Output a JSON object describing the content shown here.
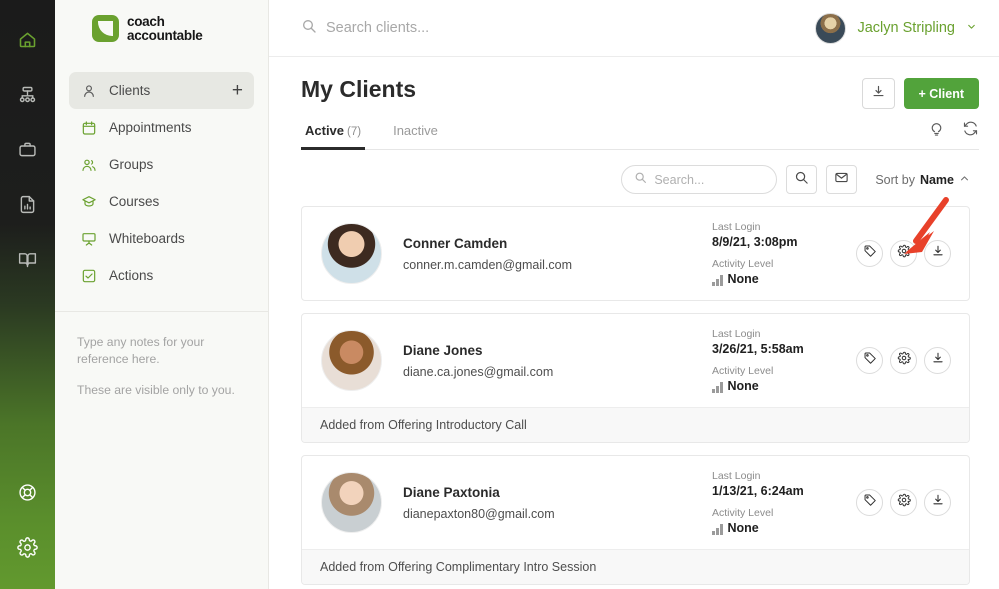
{
  "rail": {
    "items": [
      {
        "name": "home-icon",
        "active": true
      },
      {
        "name": "org-chart-icon",
        "active": false
      },
      {
        "name": "briefcase-icon",
        "active": false
      },
      {
        "name": "report-icon",
        "active": false
      },
      {
        "name": "book-icon",
        "active": false
      }
    ],
    "bottom": [
      {
        "name": "help-lifering-icon"
      },
      {
        "name": "settings-gear-icon"
      }
    ]
  },
  "sidebar": {
    "logo": {
      "line1": "coach",
      "line2": "accountable"
    },
    "nav": [
      {
        "label": "Clients",
        "icon": "person-icon",
        "active": true,
        "plus": "+"
      },
      {
        "label": "Appointments",
        "icon": "calendar-icon",
        "active": false
      },
      {
        "label": "Groups",
        "icon": "people-icon",
        "active": false
      },
      {
        "label": "Courses",
        "icon": "graduation-icon",
        "active": false
      },
      {
        "label": "Whiteboards",
        "icon": "whiteboard-icon",
        "active": false
      },
      {
        "label": "Actions",
        "icon": "checkbox-icon",
        "active": false
      }
    ],
    "notes": {
      "line1": "Type any notes for your reference here.",
      "line2": "These are visible only to you."
    }
  },
  "topbar": {
    "search_placeholder": "Search clients...",
    "user_name": "Jaclyn Stripling"
  },
  "page": {
    "title": "My Clients",
    "download_button": "download-icon",
    "add_client_button": "+ Client",
    "tabs": [
      {
        "label": "Active",
        "count": "(7)",
        "active": true
      },
      {
        "label": "Inactive",
        "count": "",
        "active": false
      }
    ],
    "tab_icons": [
      {
        "name": "lightbulb-icon"
      },
      {
        "name": "refresh-icon"
      }
    ]
  },
  "toolbar": {
    "search_placeholder": "Search...",
    "search_value": "",
    "sort_prefix": "Sort by",
    "sort_value": "Name"
  },
  "clients": [
    {
      "name": "Conner Camden",
      "email": "conner.m.camden@gmail.com",
      "last_login_label": "Last Login",
      "last_login_value": "8/9/21, 3:08pm",
      "activity_label": "Activity Level",
      "activity_value": "None",
      "footer": ""
    },
    {
      "name": "Diane Jones",
      "email": "diane.ca.jones@gmail.com",
      "last_login_label": "Last Login",
      "last_login_value": "3/26/21, 5:58am",
      "activity_label": "Activity Level",
      "activity_value": "None",
      "footer": "Added from Offering Introductory Call"
    },
    {
      "name": "Diane Paxtonia",
      "email": "dianepaxton80@gmail.com",
      "last_login_label": "Last Login",
      "last_login_value": "1/13/21, 6:24am",
      "activity_label": "Activity Level",
      "activity_value": "None",
      "footer": "Added from Offering Complimentary Intro Session"
    }
  ],
  "card_actions": [
    {
      "name": "tag-icon"
    },
    {
      "name": "gear-icon"
    },
    {
      "name": "download-icon"
    }
  ],
  "annotation": {
    "name": "red-arrow-annotation",
    "color": "#E8412A"
  },
  "colors": {
    "brand_green": "#6aa12f",
    "button_green": "#52a33b",
    "sidebar_bg": "#f8f9f6",
    "text_dark": "#2b2b2b",
    "annotation_red": "#E8412A"
  }
}
